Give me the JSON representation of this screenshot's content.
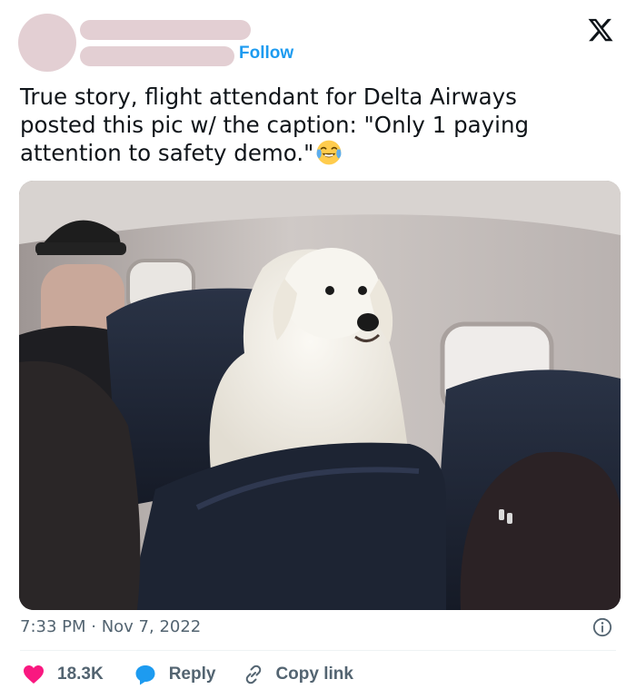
{
  "header": {
    "follow_label": "Follow",
    "logo_icon": "x-logo-icon"
  },
  "tweet": {
    "text_lines": [
      "True story, flight attendant for Delta Airways",
      "posted this pic w/ the caption: \"Only 1 paying",
      "attention to safety demo.\""
    ],
    "emoji": "face-with-tears-of-joy",
    "timestamp": "7:33 PM · Nov 7, 2022"
  },
  "actions": {
    "like_count": "18.3K",
    "reply_label": "Reply",
    "copy_link_label": "Copy link"
  },
  "colors": {
    "accent": "#1d9bf0",
    "like": "#f91880",
    "muted": "#536471",
    "placeholder": "#e3cfd3"
  }
}
